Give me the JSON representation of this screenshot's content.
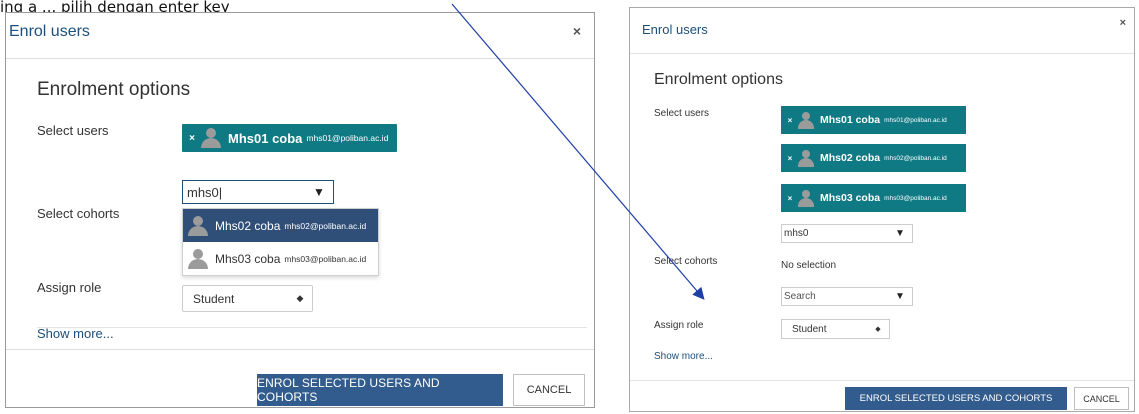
{
  "caption": "ing a ... pilih dengan enter key",
  "left": {
    "title": "Enrol users",
    "close_glyph": "×",
    "section": "Enrolment options",
    "labels": {
      "select_users": "Select users",
      "select_cohorts": "Select cohorts",
      "assign_role": "Assign role"
    },
    "chip": {
      "remove": "×",
      "name": "Mhs01 coba",
      "email": "mhs01@poliban.ac.id"
    },
    "search": {
      "value": "mhs0|",
      "arrow": "▼"
    },
    "suggestions": [
      {
        "name": "Mhs02 coba",
        "email": "mhs02@poliban.ac.id",
        "selected": true
      },
      {
        "name": "Mhs03 coba",
        "email": "mhs03@poliban.ac.id",
        "selected": false
      }
    ],
    "role": {
      "value": "Student",
      "arrow": "◆"
    },
    "show_more": "Show more...",
    "buttons": {
      "enrol": "ENROL SELECTED USERS AND COHORTS",
      "cancel": "CANCEL"
    }
  },
  "right": {
    "title": "Enrol users",
    "close_glyph": "×",
    "section": "Enrolment options",
    "labels": {
      "select_users": "Select users",
      "select_cohorts": "Select cohorts",
      "assign_role": "Assign role"
    },
    "chips": [
      {
        "remove": "×",
        "name": "Mhs01 coba",
        "email": "mhs01@poliban.ac.id"
      },
      {
        "remove": "×",
        "name": "Mhs02 coba",
        "email": "mhs02@poliban.ac.id"
      },
      {
        "remove": "×",
        "name": "Mhs03 coba",
        "email": "mhs03@poliban.ac.id"
      }
    ],
    "search": {
      "value": "mhs0",
      "arrow": "▼"
    },
    "cohorts": {
      "no_selection": "No selection",
      "placeholder": "Search",
      "arrow": "▼"
    },
    "role": {
      "value": "Student",
      "arrow": "◆"
    },
    "show_more": "Show more...",
    "buttons": {
      "enrol": "ENROL SELECTED USERS AND COHORTS",
      "cancel": "CANCEL"
    }
  },
  "colors": {
    "chip": "#0f7a84",
    "primary_button": "#325c8d",
    "selected_option": "#2f4f79",
    "link": "#1d4f7a",
    "arrow": "#1f3fa8"
  }
}
